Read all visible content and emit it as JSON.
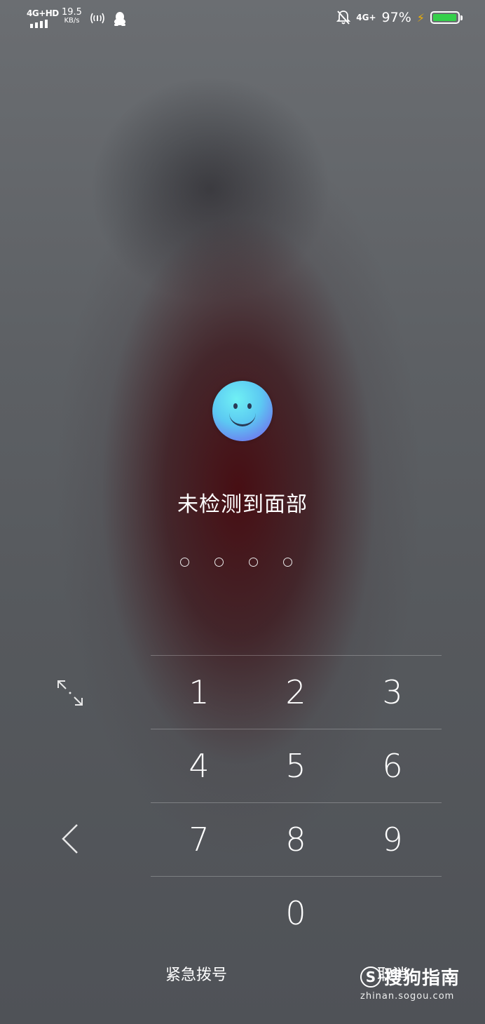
{
  "status_bar": {
    "signal_label": "4G+HD",
    "speed_value": "19.5",
    "speed_unit": "KB/s",
    "net_label": "4G+",
    "battery_percent": "97%",
    "battery_level": 0.97,
    "battery_color": "#34d04a",
    "charging_color": "#f2b200"
  },
  "lock": {
    "face_icon": "smiley-face-icon",
    "message": "未检测到面部",
    "pin_slots": 4
  },
  "keypad": {
    "rows": [
      [
        "1",
        "2",
        "3"
      ],
      [
        "4",
        "5",
        "6"
      ],
      [
        "7",
        "8",
        "9"
      ],
      [
        "",
        "0",
        ""
      ]
    ]
  },
  "actions": {
    "emergency_label": "紧急拨号",
    "cancel_label": "取消"
  },
  "watermark": {
    "brand": "搜狗指南",
    "url": "zhinan.sogou.com"
  }
}
